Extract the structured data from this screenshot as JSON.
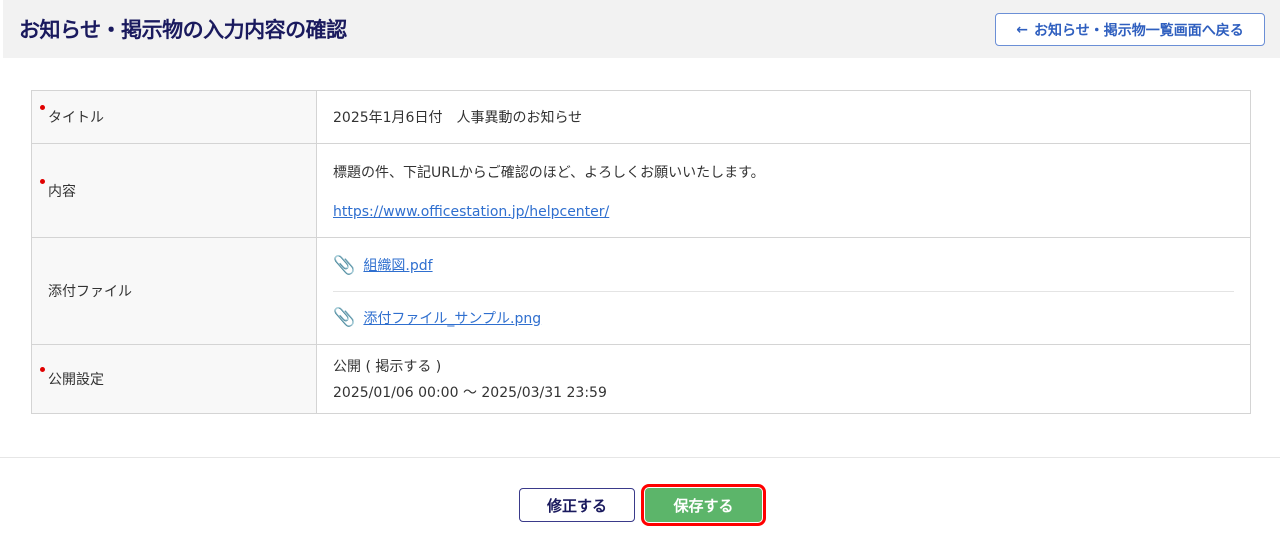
{
  "header": {
    "title": "お知らせ・掲示物の入力内容の確認",
    "back_label": "お知らせ・掲示物一覧画面へ戻る"
  },
  "rows": {
    "title": {
      "label": "タイトル",
      "value": "2025年1月6日付　人事異動のお知らせ"
    },
    "content": {
      "label": "内容",
      "text": "標題の件、下記URLからご確認のほど、よろしくお願いいたします。",
      "link": "https://www.officestation.jp/helpcenter/"
    },
    "attachments": {
      "label": "添付ファイル",
      "files": [
        "組織図.pdf",
        "添付ファイル_サンプル.png"
      ]
    },
    "publish": {
      "label": "公開設定",
      "status": "公開 ( 掲示する )",
      "period": "2025/01/06 00:00 〜 2025/03/31 23:59"
    }
  },
  "footer": {
    "edit_label": "修正する",
    "save_label": "保存する"
  },
  "colors": {
    "required": "#e00000",
    "save": "#5cb56a",
    "highlight": "#ff0000"
  }
}
